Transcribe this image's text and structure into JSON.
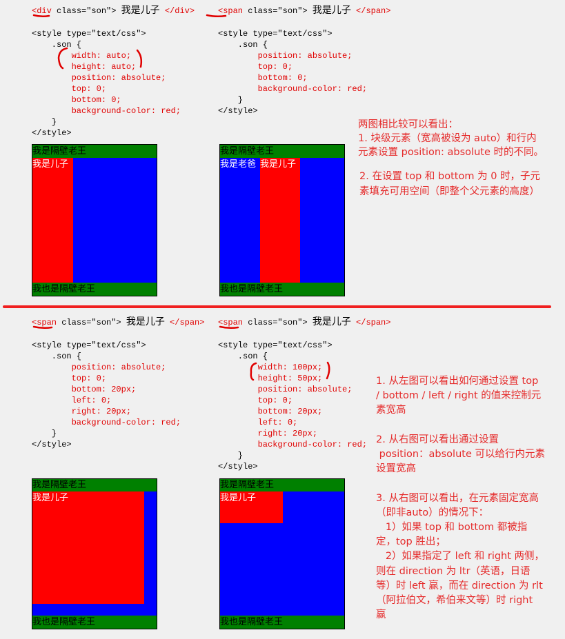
{
  "examples": [
    {
      "lines": [
        {
          "tag": "<div",
          "rest": " class=\"son\"> ",
          "cn": "我是儿子",
          "close": " </div>"
        },
        {
          "text": ""
        },
        {
          "text": "<style type=\"text/css\">"
        },
        {
          "text": "    .son {"
        },
        {
          "text": "        width: auto;",
          "red": true
        },
        {
          "text": "        height: auto;",
          "red": true
        },
        {
          "text": "        position: absolute;",
          "red": true
        },
        {
          "text": "        top: 0;",
          "red": true
        },
        {
          "text": "        bottom: 0;",
          "red": true
        },
        {
          "text": "        background-color: red;",
          "red": true
        },
        {
          "text": "    }"
        },
        {
          "text": "</style>"
        }
      ],
      "demo": {
        "header": "我是隔壁老王",
        "son": "我是儿子",
        "footer": "我也是隔壁老王"
      }
    },
    {
      "lines": [
        {
          "tag": "<span",
          "rest": " class=\"son\"> ",
          "cn": "我是儿子",
          "close": " </span>"
        },
        {
          "text": ""
        },
        {
          "text": "<style type=\"text/css\">"
        },
        {
          "text": "    .son {"
        },
        {
          "text": "        position: absolute;",
          "red": true
        },
        {
          "text": "        top: 0;",
          "red": true
        },
        {
          "text": "        bottom: 0;",
          "red": true
        },
        {
          "text": "        background-color: red;",
          "red": true
        },
        {
          "text": "    }"
        },
        {
          "text": "</style>"
        }
      ],
      "demo": {
        "header": "我是隔壁老王",
        "dad": "我是老爸",
        "son": "我是儿子",
        "footer": "我也是隔壁老王"
      }
    },
    {
      "lines": [
        {
          "tag": "<span",
          "rest": " class=\"son\"> ",
          "cn": "我是儿子",
          "close": " </span>"
        },
        {
          "text": ""
        },
        {
          "text": "<style type=\"text/css\">"
        },
        {
          "text": "    .son {"
        },
        {
          "text": "        position: absolute;",
          "red": true
        },
        {
          "text": "        top: 0;",
          "red": true
        },
        {
          "text": "        bottom: 20px;",
          "red": true
        },
        {
          "text": "        left: 0;",
          "red": true
        },
        {
          "text": "        right: 20px;",
          "red": true
        },
        {
          "text": "        background-color: red;",
          "red": true
        },
        {
          "text": "    }"
        },
        {
          "text": "</style>"
        }
      ],
      "demo": {
        "header": "我是隔壁老王",
        "son": "我是儿子",
        "footer": "我也是隔壁老王"
      }
    },
    {
      "lines": [
        {
          "tag": "<span",
          "rest": " class=\"son\"> ",
          "cn": "我是儿子",
          "close": " </span>"
        },
        {
          "text": ""
        },
        {
          "text": "<style type=\"text/css\">"
        },
        {
          "text": "    .son {"
        },
        {
          "text": "        width: 100px;",
          "red": true
        },
        {
          "text": "        height: 50px;",
          "red": true
        },
        {
          "text": "        position: absolute;",
          "red": true
        },
        {
          "text": "        top: 0;",
          "red": true
        },
        {
          "text": "        bottom: 20px;",
          "red": true
        },
        {
          "text": "        left: 0;",
          "red": true
        },
        {
          "text": "        right: 20px;",
          "red": true
        },
        {
          "text": "        background-color: red;",
          "red": true
        },
        {
          "text": "    }"
        },
        {
          "text": "</style>"
        }
      ],
      "demo": {
        "header": "我是隔壁老王",
        "son": "我是儿子",
        "footer": "我也是隔壁老王"
      }
    }
  ],
  "notes": {
    "top": "两图相比较可以看出：\n1. 块级元素（宽高被设为 auto）和行内\n元素设置 position: absolute 时的不同。",
    "top2": "2. 在设置 top 和 bottom 为 0 时，子元\n素填充可用空间（即整个父元素的高度）",
    "bottom": "1. 从左图可以看出如何通过设置 top\n/ bottom / left / right 的值来控制元\n素宽高\n\n2. 从右图可以看出通过设置\n position：absolute 可以给行内元素\n设置宽高\n\n3. 从右图可以看出，在元素固定宽高\n（即非auto）的情况下：\n   1）如果 top 和 bottom 都被指\n定，top 胜出；\n   2）如果指定了 left 和 right 两侧，\n则在 direction 为 ltr（英语，日语\n等）时 left 赢，而在 direction 为 rlt\n（阿拉伯文，希伯来文等）时 right\n赢"
  },
  "colors": {
    "parent": "#0000ff",
    "header_footer": "#008000",
    "son": "#ff0000",
    "annotation": "#e52b2b"
  }
}
